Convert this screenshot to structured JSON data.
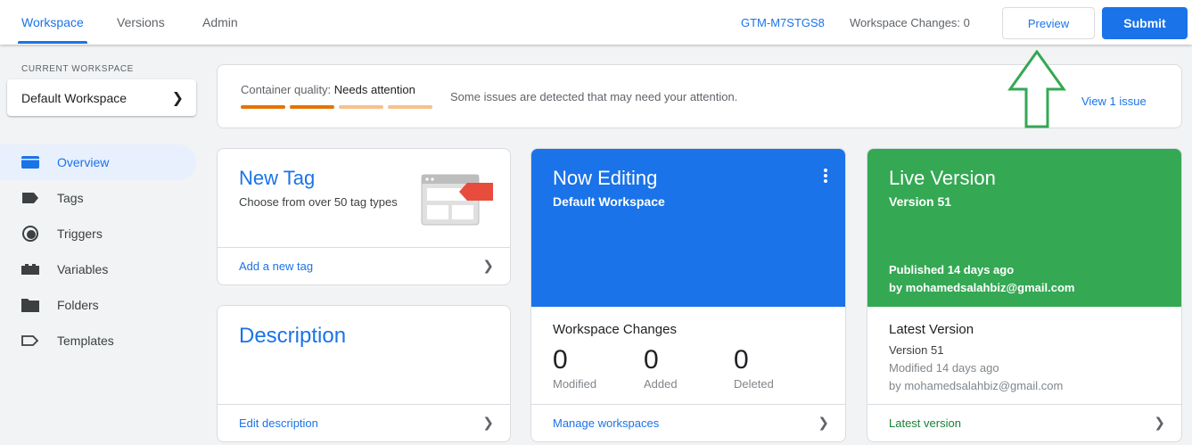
{
  "topbar": {
    "tabs": [
      "Workspace",
      "Versions",
      "Admin"
    ],
    "container_id": "GTM-M7STGS8",
    "workspace_changes": "Workspace Changes: 0",
    "preview_label": "Preview",
    "submit_label": "Submit"
  },
  "sidebar": {
    "current_workspace_label": "CURRENT WORKSPACE",
    "workspace_name": "Default Workspace",
    "items": [
      {
        "label": "Overview",
        "icon": "overview-icon",
        "active": true
      },
      {
        "label": "Tags",
        "icon": "tag-icon"
      },
      {
        "label": "Triggers",
        "icon": "trigger-icon"
      },
      {
        "label": "Variables",
        "icon": "variables-icon"
      },
      {
        "label": "Folders",
        "icon": "folder-icon"
      },
      {
        "label": "Templates",
        "icon": "template-icon"
      }
    ]
  },
  "quality": {
    "label": "Container quality: ",
    "status": "Needs attention",
    "message": "Some issues are detected that may need your attention.",
    "link": "View 1 issue",
    "bar_colors": [
      "#e37400",
      "#e37400",
      "#f6c28b",
      "#f6c28b"
    ]
  },
  "new_tag": {
    "title": "New Tag",
    "description": "Choose from over 50 tag types",
    "link": "Add a new tag"
  },
  "description_card": {
    "title": "Description",
    "link": "Edit description"
  },
  "now_editing": {
    "title": "Now Editing",
    "subtitle": "Default Workspace",
    "section_title": "Workspace Changes",
    "stats": [
      {
        "value": "0",
        "label": "Modified"
      },
      {
        "value": "0",
        "label": "Added"
      },
      {
        "value": "0",
        "label": "Deleted"
      }
    ],
    "link": "Manage workspaces"
  },
  "live_version": {
    "title": "Live Version",
    "subtitle": "Version 51",
    "published": "Published 14 days ago",
    "published_by": "by mohamedsalahbiz@gmail.com",
    "section_title": "Latest Version",
    "version": "Version 51",
    "modified": "Modified 14 days ago",
    "modified_by": "by mohamedsalahbiz@gmail.com",
    "link": "Latest version"
  },
  "colors": {
    "accent": "#1a73e8",
    "live": "#34a853",
    "arrow": "#34a853"
  }
}
